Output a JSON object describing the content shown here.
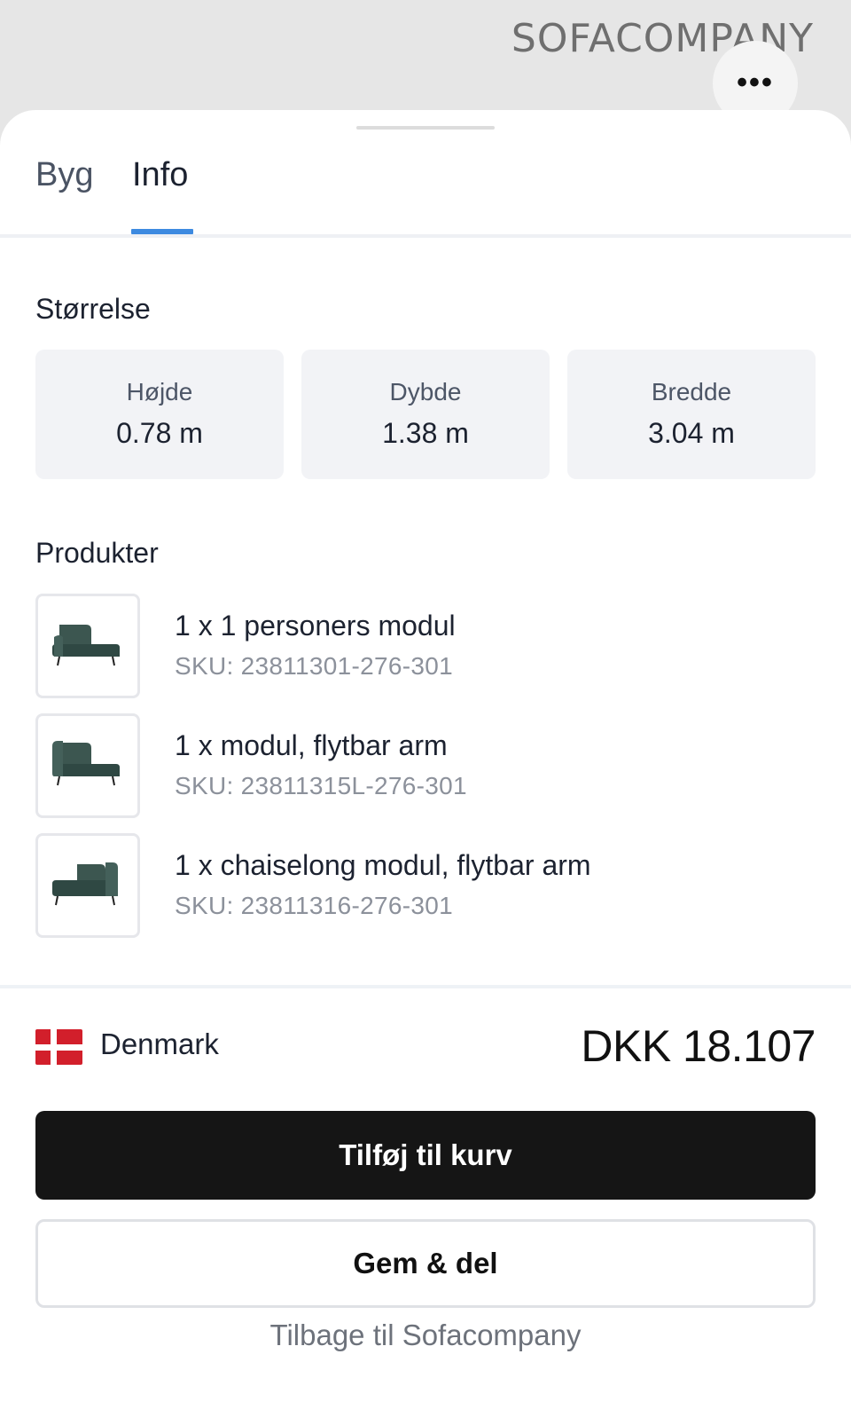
{
  "header": {
    "brand": "SOFACOMPANY",
    "more_icon": "ellipsis-icon"
  },
  "tabs": [
    {
      "label": "Byg",
      "active": false
    },
    {
      "label": "Info",
      "active": true
    }
  ],
  "size": {
    "title": "Størrelse",
    "items": [
      {
        "label": "Højde",
        "value": "0.78 m"
      },
      {
        "label": "Dybde",
        "value": "1.38 m"
      },
      {
        "label": "Bredde",
        "value": "3.04 m"
      }
    ]
  },
  "products": {
    "title": "Produkter",
    "items": [
      {
        "name": "1 x 1 personers modul",
        "sku": "SKU: 23811301-276-301",
        "icon": "sofa-module-icon"
      },
      {
        "name": "1 x modul, flytbar arm",
        "sku": "SKU: 23811315L-276-301",
        "icon": "sofa-arm-module-icon"
      },
      {
        "name": "1 x chaiselong modul, flytbar arm",
        "sku": "SKU: 23811316-276-301",
        "icon": "chaise-module-icon"
      }
    ]
  },
  "footer": {
    "country": "Denmark",
    "flag_icon": "denmark-flag-icon",
    "price": "DKK 18.107",
    "add_to_cart": "Tilføj til kurv",
    "save_share": "Gem & del",
    "back_link": "Tilbage til Sofacompany"
  },
  "colors": {
    "accent": "#3d8ae0",
    "primary_button": "#151515",
    "sofa_fabric": "#3c5650"
  }
}
